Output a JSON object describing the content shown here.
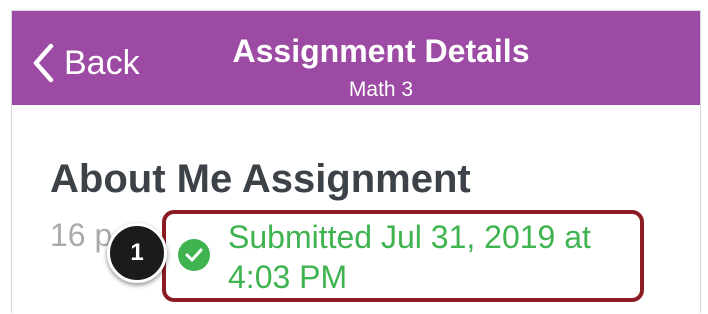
{
  "navbar": {
    "back_label": "Back",
    "title": "Assignment Details",
    "subtitle": "Math 3",
    "color": "#9c4aa3"
  },
  "assignment": {
    "title": "About Me Assignment",
    "points": "16 p",
    "status": "Submitted Jul 31, 2019 at 4:03 PM",
    "status_color": "#3fb34f",
    "status_icon": "checkmark-circle-icon"
  },
  "annotation": {
    "callout_number": "1",
    "highlight_color": "#8c1c24"
  }
}
